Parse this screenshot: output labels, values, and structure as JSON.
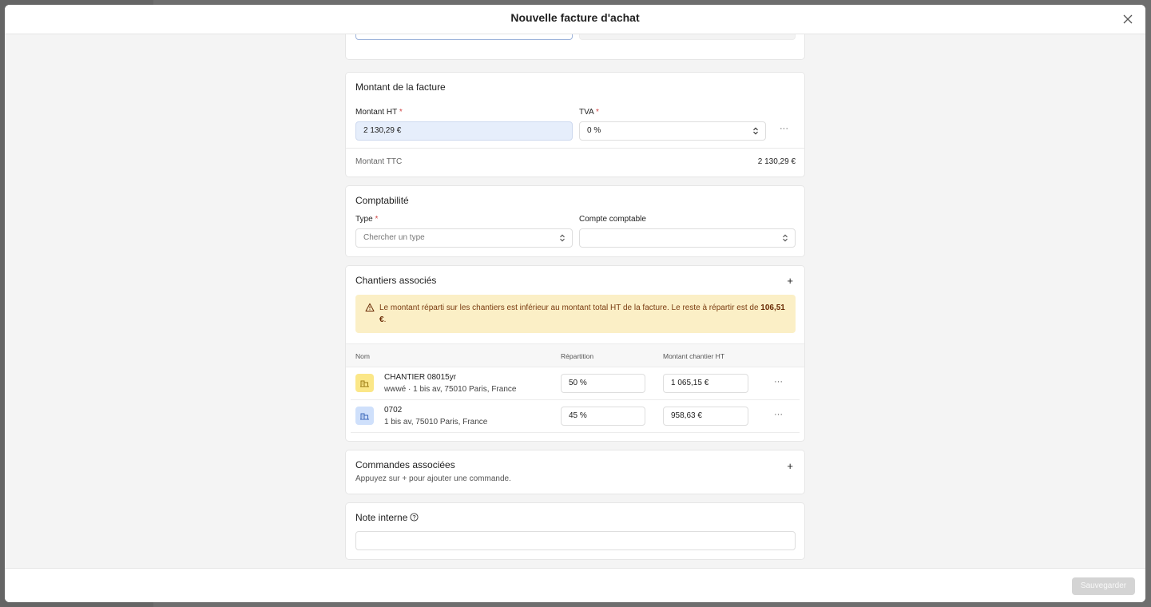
{
  "modal": {
    "title": "Nouvelle facture d'achat"
  },
  "amount": {
    "title": "Montant de la facture",
    "ht_label": "Montant HT",
    "ht_value": "2 130,29 €",
    "tva_label": "TVA",
    "tva_value": "0 %",
    "ttc_label": "Montant TTC",
    "ttc_value": "2 130,29 €",
    "required_mark": "*"
  },
  "accounting": {
    "title": "Comptabilité",
    "type_label": "Type",
    "type_placeholder": "Chercher un type",
    "account_label": "Compte comptable",
    "account_value": ""
  },
  "sites": {
    "title": "Chantiers associés",
    "add_label": "+",
    "warning_text": "Le montant réparti sur les chantiers est inférieur au montant total HT de la facture. Le reste à répartir est de ",
    "warning_amount": "106,51 €",
    "warning_end": ".",
    "columns": [
      "Nom",
      "Répartition",
      "Montant chantier HT"
    ],
    "rows": [
      {
        "name": "CHANTIER 08015yr",
        "sub": "wwwé · 1 bis av, 75010 Paris, France",
        "split": "50 %",
        "amount": "1 065,15 €",
        "icon_color": "#fbe788",
        "icon_stroke": "#9a7a10"
      },
      {
        "name": "0702",
        "sub": "1 bis av, 75010 Paris, France",
        "split": "45 %",
        "amount": "958,63 €",
        "icon_color": "#cfe0fb",
        "icon_stroke": "#3a66b8"
      }
    ]
  },
  "orders": {
    "title": "Commandes associées",
    "add_label": "+",
    "hint": "Appuyez sur + pour ajouter une commande."
  },
  "note": {
    "title": "Note interne",
    "value": ""
  },
  "footer": {
    "save_label": "Sauvegarder"
  },
  "icons": {
    "close": "close-icon",
    "chevron": "chevron-up-down-icon",
    "warning": "warning-triangle-icon",
    "building": "building-icon",
    "help": "help-circle-icon",
    "more": "more-horizontal-icon"
  }
}
